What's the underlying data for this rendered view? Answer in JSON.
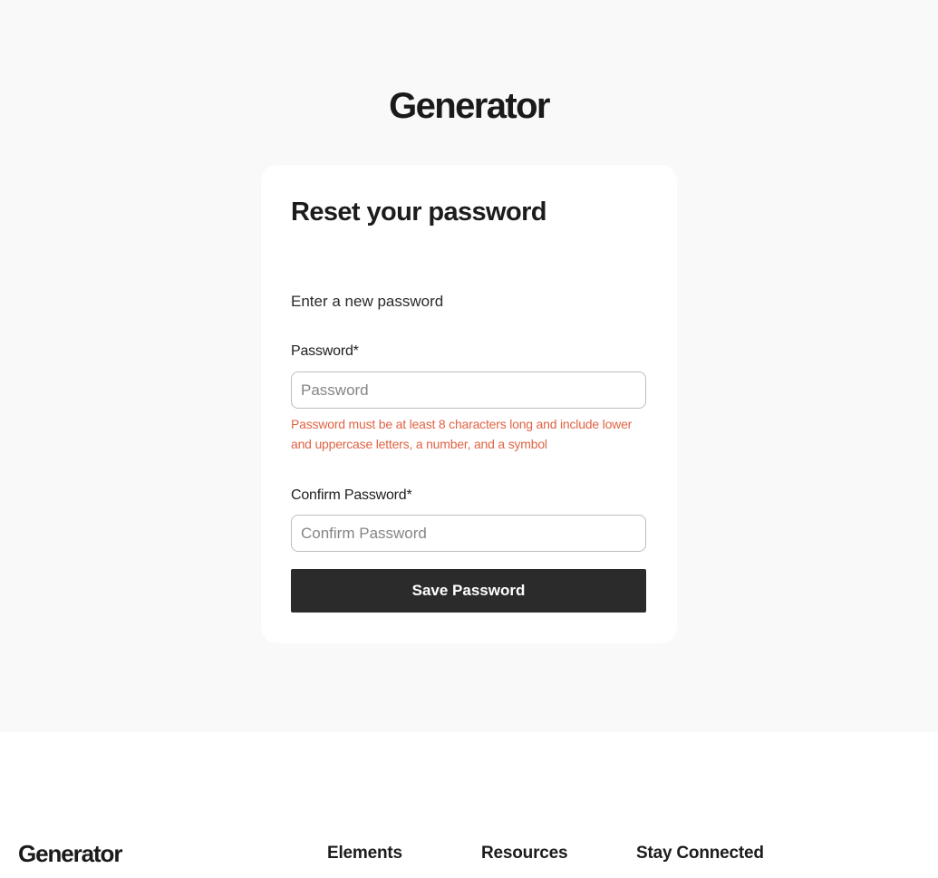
{
  "header": {
    "logo_text": "Generator"
  },
  "reset_form": {
    "title": "Reset your password",
    "subtitle": "Enter a new password",
    "password_label": "Password*",
    "password_placeholder": "Password",
    "password_error": "Password must be at least 8 characters long and include lower and uppercase letters, a number, and a symbol",
    "confirm_label": "Confirm Password*",
    "confirm_placeholder": "Confirm Password",
    "save_button_label": "Save Password"
  },
  "footer": {
    "logo_text": "Generator",
    "columns": [
      {
        "heading": "Elements"
      },
      {
        "heading": "Resources"
      },
      {
        "heading": "Stay Connected"
      }
    ]
  },
  "colors": {
    "page_background": "#f9f9f9",
    "card_background": "#ffffff",
    "button_background": "#2b2b2b",
    "error_text": "#e06445"
  }
}
